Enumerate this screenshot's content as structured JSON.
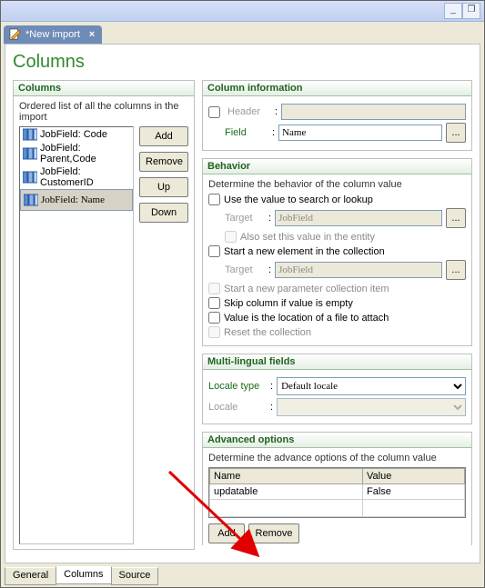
{
  "window": {
    "min_icon": "_",
    "max_icon": "❐"
  },
  "doc_tab": {
    "title": "*New import",
    "close": "×"
  },
  "page_title": "Columns",
  "columns_panel": {
    "title": "Columns",
    "desc": "Ordered list of all the columns in the import",
    "items": [
      {
        "label": "JobField: Code",
        "selected": false
      },
      {
        "label": "JobField: Parent,Code",
        "selected": false
      },
      {
        "label": "JobField: CustomerID",
        "selected": false
      },
      {
        "label": "JobField: Name",
        "selected": true
      }
    ],
    "buttons": {
      "add": "Add",
      "remove": "Remove",
      "up": "Up",
      "down": "Down"
    }
  },
  "col_info": {
    "title": "Column information",
    "header_label": "Header",
    "header_colon": ":",
    "header_checked": false,
    "header_value": "",
    "field_label": "Field",
    "field_colon": ":",
    "field_value": "Name",
    "field_btn": "..."
  },
  "behavior": {
    "title": "Behavior",
    "desc": "Determine the behavior of the column value",
    "search": {
      "label": "Use the value to search or lookup",
      "checked": false,
      "target_label": "Target",
      "colon": ":",
      "target_value": "JobField",
      "target_btn": "...",
      "also_set": {
        "label": "Also set this value in the entity",
        "checked": false
      }
    },
    "start_elem": {
      "label": "Start a new element in the collection",
      "checked": false,
      "target_label": "Target",
      "colon": ":",
      "target_value": "JobField",
      "target_btn": "..."
    },
    "start_param": {
      "label": "Start a new parameter collection item",
      "checked": false,
      "enabled": false
    },
    "skip_empty": {
      "label": "Skip column if value is empty",
      "checked": false
    },
    "file_loc": {
      "label": "Value is the location of a file to attach",
      "checked": false
    },
    "reset": {
      "label": "Reset the collection",
      "checked": false,
      "enabled": false
    }
  },
  "multi": {
    "title": "Multi-lingual fields",
    "locale_type_label": "Locale type",
    "colon": ":",
    "locale_type_value": "Default locale",
    "locale_label": "Locale",
    "locale_value": ""
  },
  "advanced": {
    "title": "Advanced options",
    "desc": "Determine the advance options of the column value",
    "headers": {
      "name": "Name",
      "value": "Value"
    },
    "rows": [
      {
        "name": "updatable",
        "value": "False"
      }
    ],
    "add": "Add",
    "remove": "Remove"
  },
  "bottom_tabs": {
    "general": "General",
    "columns": "Columns",
    "source": "Source",
    "active": "columns"
  }
}
